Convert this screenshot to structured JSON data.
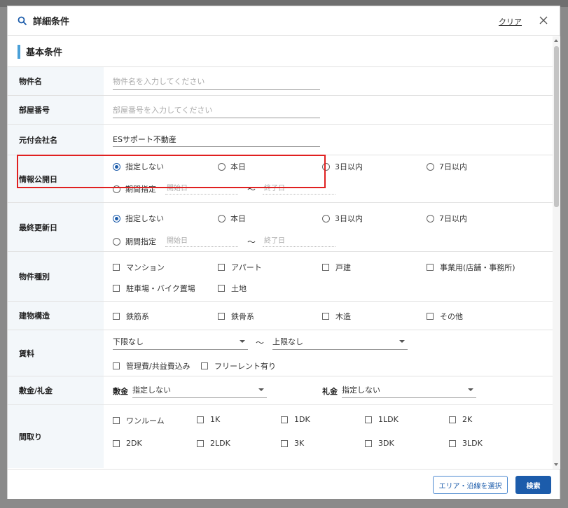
{
  "dialog": {
    "title": "詳細条件",
    "clear_label": "クリア"
  },
  "section": {
    "title": "基本条件"
  },
  "fields": {
    "property_name": {
      "label": "物件名",
      "placeholder": "物件名を入力してください",
      "value": ""
    },
    "room_number": {
      "label": "部屋番号",
      "placeholder": "部屋番号を入力してください",
      "value": ""
    },
    "original_company": {
      "label": "元付会社名",
      "placeholder": "",
      "value": "ESサポート不動産"
    }
  },
  "info_publish_date": {
    "label": "情報公開日",
    "options": [
      "指定しない",
      "本日",
      "3日以内",
      "7日以内"
    ],
    "selected": "指定しない",
    "period_label": "期間指定",
    "start_placeholder": "開始日",
    "end_placeholder": "終了日",
    "tilde": "～"
  },
  "last_update_date": {
    "label": "最終更新日",
    "options": [
      "指定しない",
      "本日",
      "3日以内",
      "7日以内"
    ],
    "selected": "指定しない",
    "period_label": "期間指定",
    "start_placeholder": "開始日",
    "end_placeholder": "終了日",
    "tilde": "～"
  },
  "property_type": {
    "label": "物件種別",
    "options": [
      "マンション",
      "アパート",
      "戸建",
      "事業用(店舗・事務所)",
      "駐車場・バイク置場",
      "土地"
    ]
  },
  "structure": {
    "label": "建物構造",
    "options": [
      "鉄筋系",
      "鉄骨系",
      "木造",
      "その他"
    ]
  },
  "rent": {
    "label": "賃料",
    "min_value": "下限なし",
    "max_value": "上限なし",
    "tilde": "～",
    "options": [
      "管理費/共益費込み",
      "フリーレント有り"
    ]
  },
  "deposit_key": {
    "label": "敷金/礼金",
    "deposit_label": "敷金",
    "deposit_value": "指定しない",
    "key_label": "礼金",
    "key_value": "指定しない"
  },
  "layout": {
    "label": "間取り",
    "options": [
      "ワンルーム",
      "1K",
      "1DK",
      "1LDK",
      "2K",
      "2DK",
      "2LDK",
      "3K",
      "3DK",
      "3LDK"
    ]
  },
  "footer": {
    "area_button": "エリア・沿線を選択",
    "search_button": "検索"
  },
  "colors": {
    "accent": "#1c5cab",
    "highlight": "#e02020",
    "section_bar": "#4aa0d8",
    "label_bg": "#f3f7fa"
  }
}
